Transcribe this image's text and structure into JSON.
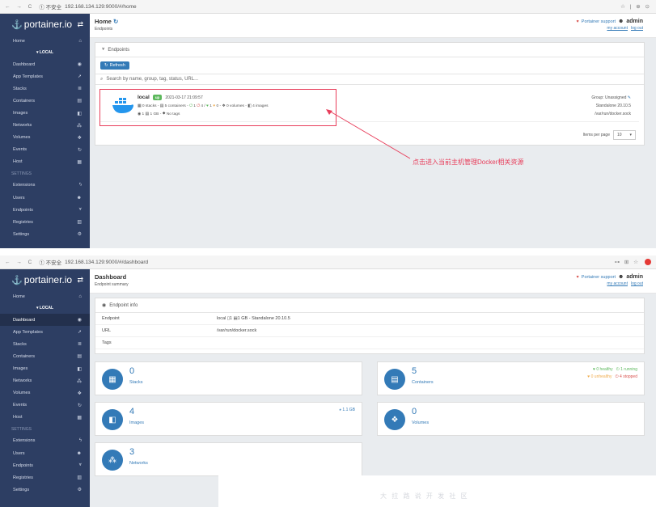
{
  "shot1": {
    "browser": {
      "nav": "← → C",
      "insecure": "① 不安全",
      "url": "192.168.134.129:9000/#/home",
      "tools": "☆ | ⊕ ⊙"
    },
    "brand": {
      "logo_text": "portainer.io",
      "toggle": "⇄"
    },
    "sidebar": [
      {
        "label": "Home",
        "icon": "⌂"
      },
      {
        "label": "Dashboard",
        "icon": "◉"
      },
      {
        "label": "App Templates",
        "icon": "➚"
      },
      {
        "label": "Stacks",
        "icon": "≣"
      },
      {
        "label": "Containers",
        "icon": "▤"
      },
      {
        "label": "Images",
        "icon": "◧"
      },
      {
        "label": "Networks",
        "icon": "⁂"
      },
      {
        "label": "Volumes",
        "icon": "❖"
      },
      {
        "label": "Events",
        "icon": "↻"
      },
      {
        "label": "Host",
        "icon": "▦"
      },
      {
        "label": "Extensions",
        "icon": "ϟ"
      },
      {
        "label": "Users",
        "icon": "☻"
      },
      {
        "label": "Endpoints",
        "icon": "⩔"
      },
      {
        "label": "Registries",
        "icon": "▥"
      },
      {
        "label": "Settings",
        "icon": "⚙"
      }
    ],
    "local_label": "▾ LOCAL",
    "settings_section": "SETTINGS",
    "header": {
      "title": "Home",
      "refresh_icon": "↻",
      "subtitle": "Endpoints",
      "support": "Portainer support",
      "user": "admin",
      "my_account": "my account",
      "log_out": "log out"
    },
    "panel": {
      "title": "Endpoints",
      "refresh": "Refresh",
      "search_placeholder": "Search by name, group, tag, status, URL..."
    },
    "endpoint": {
      "name": "local",
      "status": "up",
      "date": "2021-03-17 21:09:57",
      "stacks": "0 stacks",
      "containers": "5 containers",
      "running": "1",
      "stopped": "4",
      "healthy": "1",
      "unhealthy": "0",
      "volumes": "0 volumes",
      "images": "4 images",
      "cpu": "1",
      "memory": "1 GB",
      "tags": "No tags",
      "group": "Group: Unassigned",
      "standalone": "Standalone 20.10.5",
      "socket": "/var/run/docker.sock"
    },
    "pager": {
      "label": "Items per page",
      "value": "10"
    },
    "annotation": "点击进入当前主机管理Docker相关资源"
  },
  "shot2": {
    "browser": {
      "nav": "← → C",
      "insecure": "① 不安全",
      "url": "192.168.134.129:9000/#/dashboard",
      "tools": "⊶ ⊞ ☆"
    },
    "brand": {
      "logo_text": "portainer.io",
      "toggle": "⇄"
    },
    "header": {
      "title": "Dashboard",
      "subtitle": "Endpoint summary",
      "support": "Portainer support",
      "user": "admin",
      "my_account": "my account",
      "log_out": "log out"
    },
    "info_title": "Endpoint info",
    "info": [
      {
        "key": "Endpoint",
        "value": "local ▯1 ▤1 GB - Standalone 20.10.5"
      },
      {
        "key": "URL",
        "value": "/var/run/docker.sock"
      },
      {
        "key": "Tags",
        "value": ""
      }
    ],
    "tiles": {
      "stacks": {
        "num": "0",
        "label": "Stacks"
      },
      "containers": {
        "num": "5",
        "label": "Containers",
        "healthy": "0 healthy",
        "running": "1 running",
        "unhealthy": "0 unhealthy",
        "stopped": "4 stopped"
      },
      "images": {
        "num": "4",
        "label": "Images",
        "size": "1.1 GB"
      },
      "volumes": {
        "num": "0",
        "label": "Volumes"
      },
      "networks": {
        "num": "3",
        "label": "Networks"
      }
    },
    "watermark": "大 拉 路 说 开 发 社 区"
  },
  "colors": {
    "sidebar": "#2d3e63",
    "accent": "#337ab7",
    "highlight": "#e83e5b",
    "up_badge": "#5cb85c"
  }
}
